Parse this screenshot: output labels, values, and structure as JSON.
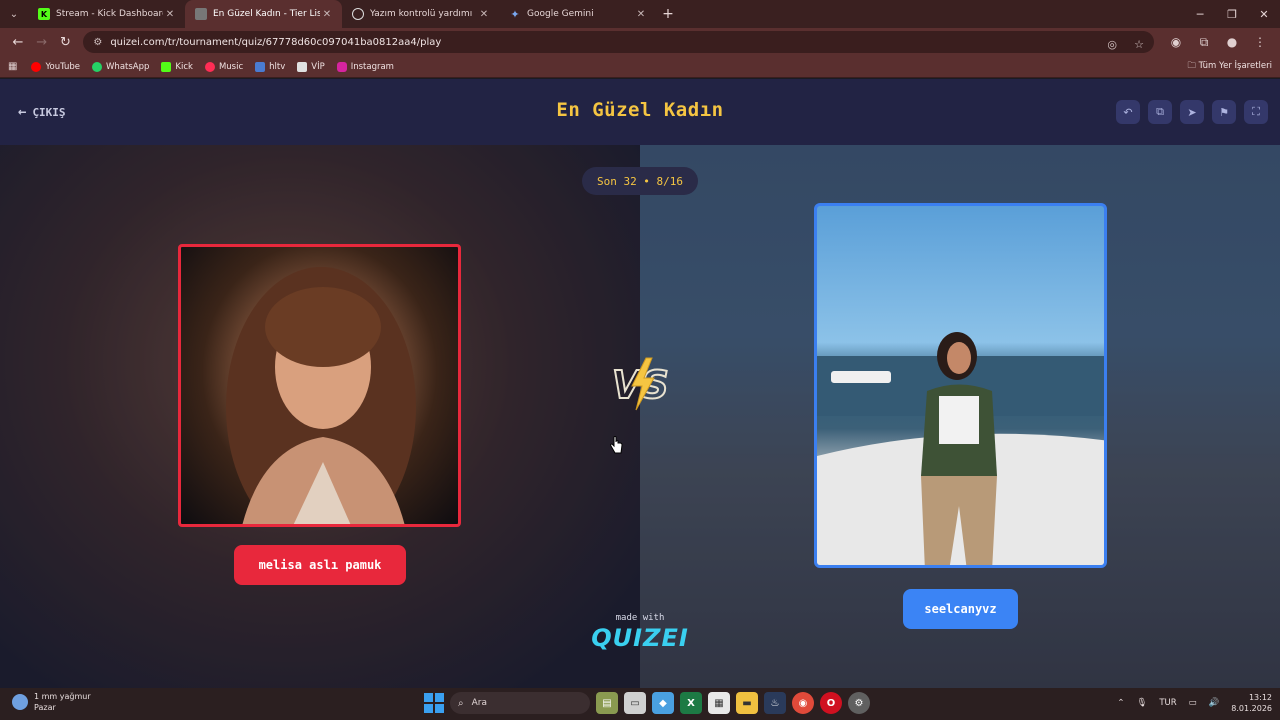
{
  "browser": {
    "tabs": [
      {
        "label": "Stream - Kick Dashboard",
        "active": false,
        "favicon_color": "#53fc18"
      },
      {
        "label": "En Güzel Kadın - Tier List, Kör S",
        "active": true,
        "favicon_color": "#8a8a8a"
      },
      {
        "label": "Yazım kontrolü yardımı",
        "active": false,
        "favicon_color": "#d0d0d0"
      },
      {
        "label": "Google Gemini",
        "active": false,
        "favicon_color": "#7aa8f0"
      }
    ],
    "url": "quizei.com/tr/tournament/quiz/67778d60c097041ba0812aa4/play",
    "bookmarks": [
      {
        "label": "YouTube",
        "color": "#ff0000"
      },
      {
        "label": "WhatsApp",
        "color": "#25d366"
      },
      {
        "label": "Kick",
        "color": "#53fc18"
      },
      {
        "label": "Music",
        "color": "#ff2d55"
      },
      {
        "label": "hltv",
        "color": "#4a7bd0"
      },
      {
        "label": "VİP",
        "color": "#e0e0e0"
      },
      {
        "label": "Instagram",
        "color": "#d6249f"
      }
    ],
    "all_bookmarks": "Tüm Yer İşaretleri"
  },
  "page": {
    "back_label": "ÇIKIŞ",
    "title": "En Güzel Kadın",
    "round_label": "Son 32 • 8/16",
    "left_name": "melisa aslı pamuk",
    "right_name": "seelcanyvz",
    "made_with": "made with",
    "logo": "QUIZEI",
    "colors": {
      "accent": "#f5c542",
      "left": "#e8283c",
      "right": "#3b84f5",
      "logo": "#3ad0f0"
    }
  },
  "taskbar": {
    "weather_line1": "1 mm yağmur",
    "weather_line2": "Pazar",
    "search_placeholder": "Ara",
    "lang": "TUR",
    "time": "13:12",
    "date": "8.01.2026"
  }
}
